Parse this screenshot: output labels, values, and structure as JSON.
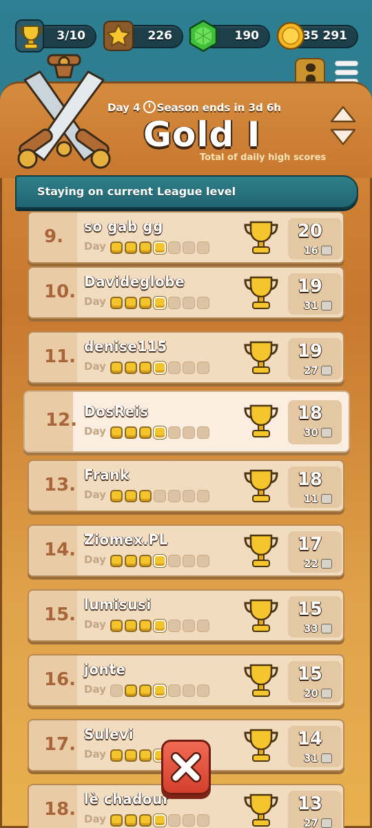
{
  "resources": [
    {
      "name": "trophies",
      "value": "3/10",
      "icon": "trophy-icon"
    },
    {
      "name": "stars",
      "value": "226",
      "icon": "star-icon"
    },
    {
      "name": "gems",
      "value": "190",
      "icon": "gem-icon"
    },
    {
      "name": "coins",
      "value": "35 291",
      "icon": "coin-icon"
    }
  ],
  "header": {
    "day": "Day 4",
    "season": "Season ends in 3d 6h",
    "league": "Gold I",
    "subtitle": "Total of daily high scores"
  },
  "banner": "Staying on current League level",
  "day_label": "Day",
  "rows": [
    {
      "rank": "9.",
      "name": "so gab gg",
      "score": "20",
      "sub": "16",
      "days_filled": 4,
      "today": 4
    },
    {
      "rank": "10.",
      "name": "Davideglobe",
      "score": "19",
      "sub": "31",
      "days_filled": 4,
      "today": 4
    },
    {
      "rank": "11.",
      "name": "denise115",
      "score": "19",
      "sub": "27",
      "days_filled": 4,
      "today": 4
    },
    {
      "rank": "12.",
      "name": "DosReis",
      "score": "18",
      "sub": "30",
      "days_filled": 4,
      "today": 4,
      "me": true
    },
    {
      "rank": "13.",
      "name": "Frank",
      "score": "18",
      "sub": "11",
      "days_filled": 3,
      "today": 4
    },
    {
      "rank": "14.",
      "name": "Ziomex.PL",
      "score": "17",
      "sub": "22",
      "days_filled": 4,
      "today": 4
    },
    {
      "rank": "15.",
      "name": "lumisusi",
      "score": "15",
      "sub": "33",
      "days_filled": 4,
      "today": 4
    },
    {
      "rank": "16.",
      "name": "jonte",
      "score": "15",
      "sub": "20",
      "days_filled": 4,
      "today": 4,
      "skip_first": true
    },
    {
      "rank": "17.",
      "name": "Sulevi",
      "score": "14",
      "sub": "31",
      "days_filled": 4,
      "today": 4
    },
    {
      "rank": "18.",
      "name": "lè chadouf",
      "score": "13",
      "sub": "27",
      "days_filled": 4,
      "today": 4
    }
  ],
  "colors": {
    "background": "#2c7486",
    "panel": "#d7893a",
    "row": "#f2dcc0",
    "row_me": "#fbeee0",
    "dot_on": "#f4c42c",
    "close": "#e0523f"
  }
}
